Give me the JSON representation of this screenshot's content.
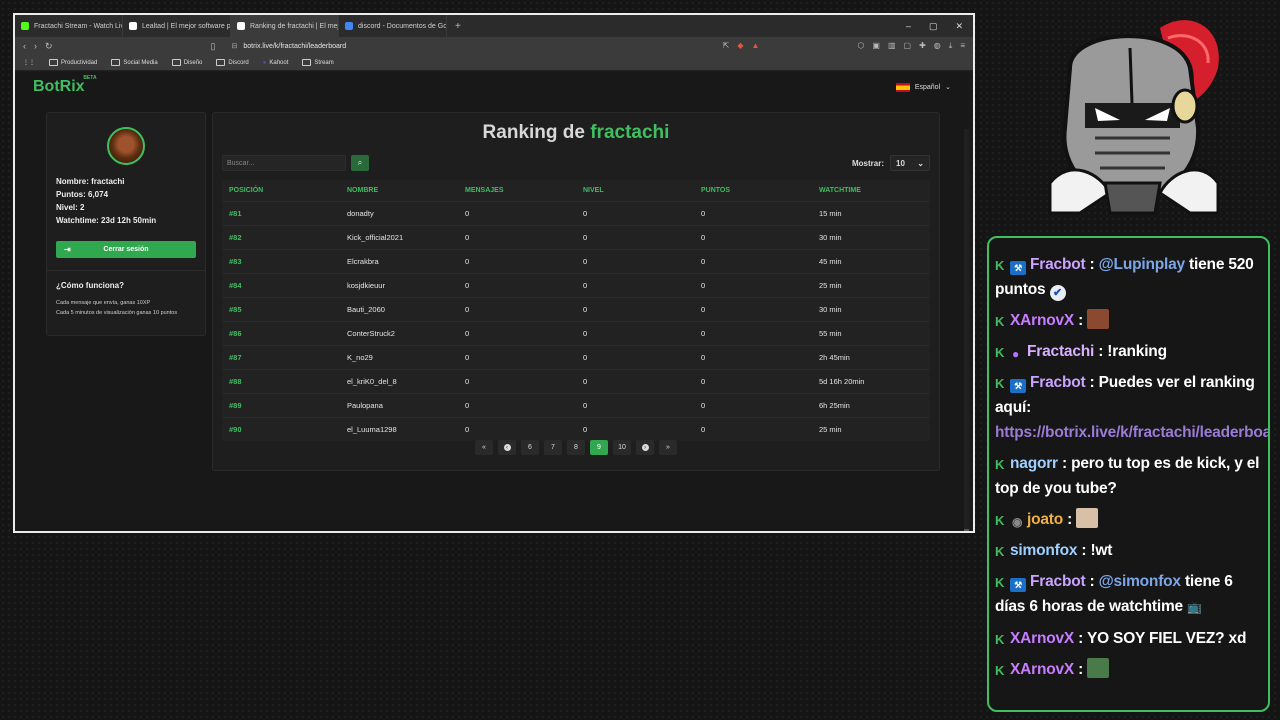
{
  "browser": {
    "tabs": [
      {
        "title": "Fractachi Stream - Watch Live on Kick",
        "color": "#53fc18"
      },
      {
        "title": "Lealtad | El mejor software para pote",
        "color": "#ffffff"
      },
      {
        "title": "Ranking de fractachi | El mejor s",
        "color": "#ffffff",
        "active": true
      },
      {
        "title": "discord - Documentos de Google",
        "color": "#4285f4"
      }
    ],
    "new_tab": "+",
    "url": "botrix.live/k/fractachi/leaderboard",
    "bookmarks": [
      "Productividad",
      "Social Media",
      "Diseño",
      "Discord",
      "Kahoot",
      "Stream"
    ]
  },
  "page": {
    "logo": "BotRix",
    "logo_badge": "BETA",
    "language": "Español",
    "profile": {
      "name_line": "Nombre: fractachi",
      "points_line": "Puntos: 6,074",
      "level_line": "Nivel: 2",
      "watchtime_line": "Watchtime: 23d 12h 50min",
      "logout": "Cerrar sesión",
      "how_title": "¿Cómo funciona?",
      "how_1": "Cada mensaje que envía, ganas 10XP",
      "how_2": "Cada 5 minutos de visualización ganas 10 puntos"
    },
    "ranking_prefix": "Ranking de",
    "ranking_user": "fractachi",
    "search_placeholder": "Buscar...",
    "show_label": "Mostrar:",
    "show_value": "10",
    "columns": [
      "POSICIÓN",
      "NOMBRE",
      "MENSAJES",
      "NIVEL",
      "PUNTOS",
      "WATCHTIME"
    ],
    "rows": [
      [
        "#81",
        "donadty",
        "0",
        "0",
        "0",
        "15 min"
      ],
      [
        "#82",
        "Kick_official2021",
        "0",
        "0",
        "0",
        "30 min"
      ],
      [
        "#83",
        "Elcrakbra",
        "0",
        "0",
        "0",
        "45 min"
      ],
      [
        "#84",
        "kosjdkieuur",
        "0",
        "0",
        "0",
        "25 min"
      ],
      [
        "#85",
        "Bauti_2060",
        "0",
        "0",
        "0",
        "30 min"
      ],
      [
        "#86",
        "ConterStruck2",
        "0",
        "0",
        "0",
        "55 min"
      ],
      [
        "#87",
        "K_no29",
        "0",
        "0",
        "0",
        "2h 45min"
      ],
      [
        "#88",
        "el_kriK0_del_8",
        "0",
        "0",
        "0",
        "5d 16h 20min"
      ],
      [
        "#89",
        "Paulopana",
        "0",
        "0",
        "0",
        "6h 25min"
      ],
      [
        "#90",
        "el_Luuma1298",
        "0",
        "0",
        "0",
        "25 min"
      ]
    ],
    "pages": [
      "6",
      "7",
      "8",
      "9",
      "10"
    ],
    "current_page": "9"
  },
  "chat": [
    {
      "user": "Fracbot",
      "color": "#c9a3ff",
      "badge": "bot",
      "parts": [
        " : ",
        {
          "m": "@Lupinplay"
        },
        " tiene 520 puntos "
      ],
      "check": true
    },
    {
      "user": "XArnovX",
      "color": "#c77dff",
      "parts": [
        " : "
      ],
      "emote": "#8b4a2f"
    },
    {
      "user": "Fractachi",
      "color": "#d7b0ff",
      "badge": "mic",
      "parts": [
        " : !ranking"
      ]
    },
    {
      "user": "Fracbot",
      "color": "#c9a3ff",
      "badge": "bot",
      "parts": [
        " : Puedes ver el ranking aquí: "
      ],
      "link": "https://botrix.live/k/fractachi/leaderboard"
    },
    {
      "user": "nagorr",
      "color": "#9fd0ff",
      "parts": [
        " : pero tu top es de kick, y el top de you tube?"
      ]
    },
    {
      "user": "joato",
      "color": "#f0b040",
      "badge": "circle",
      "parts": [
        " : "
      ],
      "emote": "#d8c0a8"
    },
    {
      "user": "simonfox",
      "color": "#9fd0ff",
      "parts": [
        " : !wt"
      ]
    },
    {
      "user": "Fracbot",
      "color": "#c9a3ff",
      "badge": "bot",
      "parts": [
        " : ",
        {
          "m": "@simonfox"
        },
        " tiene 6 días 6 horas de watchtime "
      ],
      "tv": true
    },
    {
      "user": "XArnovX",
      "color": "#c77dff",
      "parts": [
        " : YO SOY FIEL VEZ? xd"
      ]
    },
    {
      "user": "XArnovX",
      "color": "#c77dff",
      "parts": [
        " : "
      ],
      "emote": "#4a7a4a"
    }
  ]
}
